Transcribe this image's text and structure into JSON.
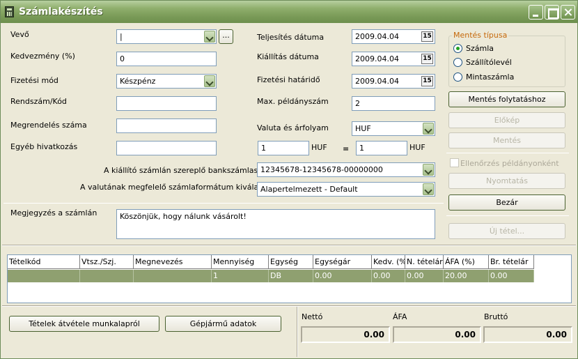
{
  "window": {
    "title": "Számlakészítés"
  },
  "form": {
    "vevo_label": "Vevő",
    "vevo_value": "|",
    "vevo_browse": "...",
    "kedvezmeny_label": "Kedvezmény (%)",
    "kedvezmeny_value": "0",
    "fizetesi_mod_label": "Fizetési mód",
    "fizetesi_mod_value": "Készpénz",
    "rendszam_label": "Rendszám/Kód",
    "rendszam_value": "",
    "megrendeles_label": "Megrendelés száma",
    "megrendeles_value": "",
    "egyeb_label": "Egyéb hivatkozás",
    "egyeb_value": "",
    "teljesites_label": "Teljesítés dátuma",
    "teljesites_value": "2009.04.04",
    "kiallitas_label": "Kiállítás dátuma",
    "kiallitas_value": "2009.04.04",
    "hatarido_label": "Fizetési határidő",
    "hatarido_value": "2009.04.04",
    "max_peldany_label": "Max. példányszám",
    "max_peldany_value": "2",
    "valuta_label": "Valuta és árfolyam",
    "valuta_value": "HUF",
    "arfolyam_left": "1",
    "arfolyam_left_unit": "HUF",
    "arfolyam_eq": "=",
    "arfolyam_right": "1",
    "arfolyam_right_unit": "HUF",
    "bankszamla_label": "A kiállító számlán szereplő bankszámlaszáma",
    "bankszamla_value": "12345678-12345678-00000000",
    "formatum_label": "A valutának megfelelő számlaformátum kiválasztása",
    "formatum_value": "Alapertelmezett - Default",
    "megjegyzes_label": "Megjegyzés a számlán",
    "megjegyzes_value": "Köszönjük, hogy nálunk vásárolt!",
    "date_btn": "15"
  },
  "save_type": {
    "title": "Mentés típusa",
    "options": [
      "Számla",
      "Szállítólevél",
      "Mintaszámla"
    ],
    "selected": "Számla"
  },
  "actions": {
    "mentes_folytatas": "Mentés folytatáshoz",
    "elokep": "Előkép",
    "mentes": "Mentés",
    "ellenorzes": "Ellenőrzés példányonként",
    "nyomtatas": "Nyomtatás",
    "bezar": "Bezár",
    "uj_tetel": "Új tétel..."
  },
  "table": {
    "columns": [
      "Tételkód",
      "Vtsz./Szj.",
      "Megnevezés",
      "Mennyiség",
      "Egység",
      "Egységár",
      "Kedv. (%)",
      "N. tételár",
      "ÁFA (%)",
      "Br. tételár"
    ],
    "rows": [
      [
        "",
        "",
        "",
        "1",
        "DB",
        "0.00",
        "0.00",
        "0.00",
        "20.00",
        "0.00"
      ]
    ]
  },
  "bottom": {
    "tetelek_btn": "Tételek átvétele munkalapról",
    "gepjarmu_btn": "Gépjármű adatok",
    "netto_label": "Nettó",
    "netto_value": "0.00",
    "afa_label": "ÁFA",
    "afa_value": "0.00",
    "brutto_label": "Bruttó",
    "brutto_value": "0.00"
  }
}
